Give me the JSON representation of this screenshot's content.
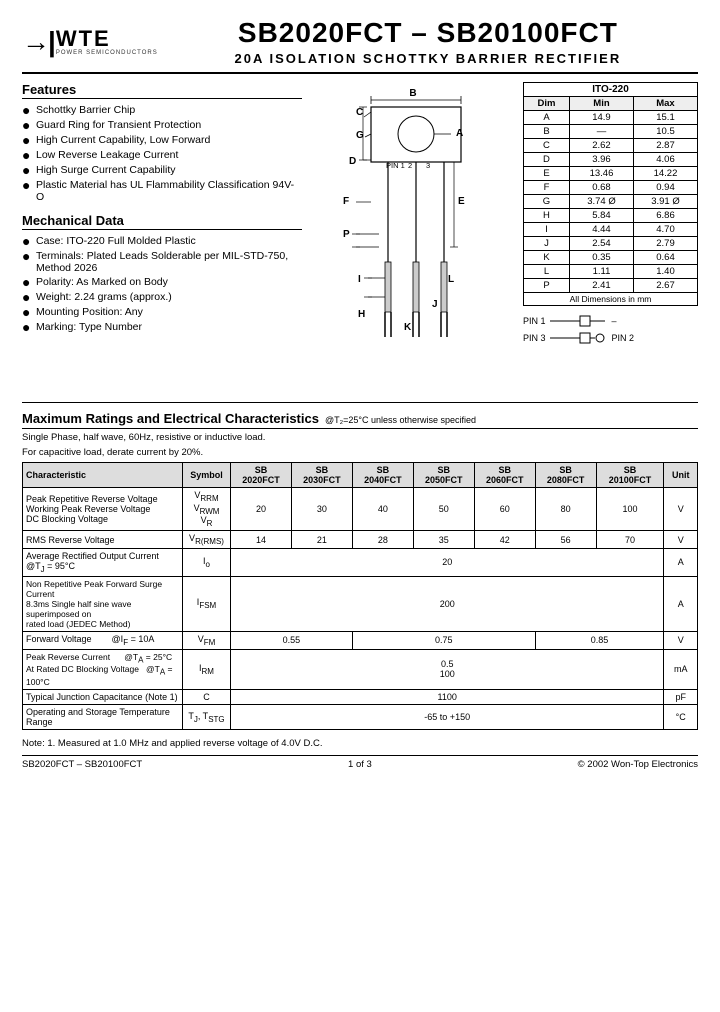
{
  "header": {
    "logo_symbol": "→|",
    "logo_wte": "WTE",
    "logo_sub": "POWER SEMICONDUCTORS",
    "main_title": "SB2020FCT – SB20100FCT",
    "sub_title": "20A ISOLATION SCHOTTKY BARRIER RECTIFIER"
  },
  "features": {
    "title": "Features",
    "items": [
      "Schottky Barrier Chip",
      "Guard Ring for Transient Protection",
      "High Current Capability, Low Forward",
      "Low Reverse Leakage Current",
      "High Surge Current Capability",
      "Plastic Material has UL Flammability Classification 94V-O"
    ]
  },
  "mechanical": {
    "title": "Mechanical Data",
    "items": [
      "Case: ITO-220 Full Molded Plastic",
      "Terminals: Plated Leads Solderable per MIL-STD-750, Method 2026",
      "Polarity: As Marked on Body",
      "Weight: 2.24 grams (approx.)",
      "Mounting Position: Any",
      "Marking: Type Number"
    ]
  },
  "dim_table": {
    "package": "ITO-220",
    "headers": [
      "Dim",
      "Min",
      "Max"
    ],
    "rows": [
      [
        "A",
        "14.9",
        "15.1"
      ],
      [
        "B",
        "—",
        "10.5"
      ],
      [
        "C",
        "2.62",
        "2.87"
      ],
      [
        "D",
        "3.96",
        "4.06"
      ],
      [
        "E",
        "13.46",
        "14.22"
      ],
      [
        "F",
        "0.68",
        "0.94"
      ],
      [
        "G",
        "3.74 Ø",
        "3.91 Ø"
      ],
      [
        "H",
        "5.84",
        "6.86"
      ],
      [
        "I",
        "4.44",
        "4.70"
      ],
      [
        "J",
        "2.54",
        "2.79"
      ],
      [
        "K",
        "0.35",
        "0.64"
      ],
      [
        "L",
        "1.11",
        "1.40"
      ],
      [
        "P",
        "2.41",
        "2.67"
      ]
    ],
    "footer": "All Dimensions in mm"
  },
  "ratings": {
    "title": "Maximum Ratings and Electrical Characteristics",
    "note": "@T₂=25°C unless otherwise specified",
    "desc1": "Single Phase, half wave, 60Hz, resistive or inductive load.",
    "desc2": "For capacitive load, derate current by 20%.",
    "col_headers": [
      "Characteristic",
      "Symbol",
      "SB\n2020FCT",
      "SB\n2030FCT",
      "SB\n2040FCT",
      "SB\n2050FCT",
      "SB\n2060FCT",
      "SB\n2080FCT",
      "SB\n20100FCT",
      "Unit"
    ],
    "rows": [
      {
        "char": "Peak Repetitive Reverse Voltage\nWorking Peak Reverse Voltage\nDC Blocking Voltage",
        "symbol": "VRRM\nVRWM\nVR",
        "vals": [
          "20",
          "30",
          "40",
          "50",
          "60",
          "80",
          "100"
        ],
        "unit": "V"
      },
      {
        "char": "RMS Reverse Voltage",
        "symbol": "VR(RMS)",
        "vals": [
          "14",
          "21",
          "28",
          "35",
          "42",
          "56",
          "70"
        ],
        "unit": "V"
      },
      {
        "char": "Average Rectified Output Current   @Tⱼ = 95°C",
        "symbol": "Io",
        "vals_span": "20",
        "unit": "A"
      },
      {
        "char": "Non Repetitive Peak Forward Surge Current\n8.3ms Single half sine wave superimposed on\nrated load (JEDEC Method)",
        "symbol": "IFSM",
        "vals_span": "200",
        "unit": "A"
      },
      {
        "char": "Forward Voltage          @IF = 10A",
        "symbol": "VFM",
        "vals_3span": [
          {
            "span": 2,
            "val": "0.55"
          },
          {
            "span": 3,
            "val": "0.75"
          },
          {
            "span": 2,
            "val": "0.85"
          }
        ],
        "unit": "V"
      },
      {
        "char": "Peak Reverse Current       @Tⱼ = 25°C\nAt Rated DC Blocking Voltage  @Tⱼ = 100°C",
        "symbol": "IRM",
        "vals_split": [
          {
            "span": 7,
            "vals": [
              "0.5",
              "100"
            ]
          }
        ],
        "unit": "mA"
      },
      {
        "char": "Typical Junction Capacitance (Note 1)",
        "symbol": "C",
        "vals_span": "1100",
        "unit": "pF"
      },
      {
        "char": "Operating and Storage Temperature Range",
        "symbol": "TJ, TSTG",
        "vals_span": "-65 to +150",
        "unit": "°C"
      }
    ]
  },
  "footer": {
    "note": "Note:   1. Measured at 1.0 MHz and applied reverse voltage of 4.0V D.C.",
    "left": "SB2020FCT – SB20100FCT",
    "center": "1 of 3",
    "right": "© 2002 Won-Top Electronics"
  }
}
